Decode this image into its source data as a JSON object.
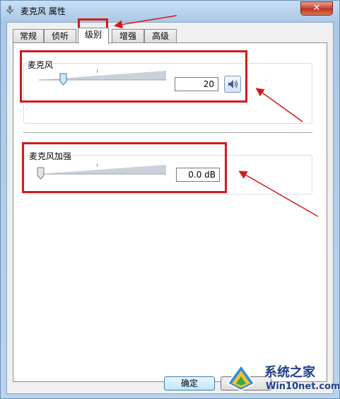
{
  "window": {
    "title": "麦克风 属性",
    "close_label": "✕"
  },
  "tabs": [
    {
      "label": "常规"
    },
    {
      "label": "侦听"
    },
    {
      "label": "级别",
      "active": true
    },
    {
      "label": "增强"
    },
    {
      "label": "高级"
    }
  ],
  "levels": {
    "microphone": {
      "label": "麦克风",
      "value": "20",
      "level_fraction": 0.2
    },
    "boost": {
      "label": "麦克风加强",
      "value": "0.0 dB",
      "level_fraction": 0.0
    }
  },
  "buttons": {
    "ok_label": "确定"
  },
  "watermark": {
    "title": "系统之家",
    "site": "Win10net.com"
  },
  "colors": {
    "annotation_red": "#d41a1a",
    "ok_button_border": "#3c7fb1"
  }
}
